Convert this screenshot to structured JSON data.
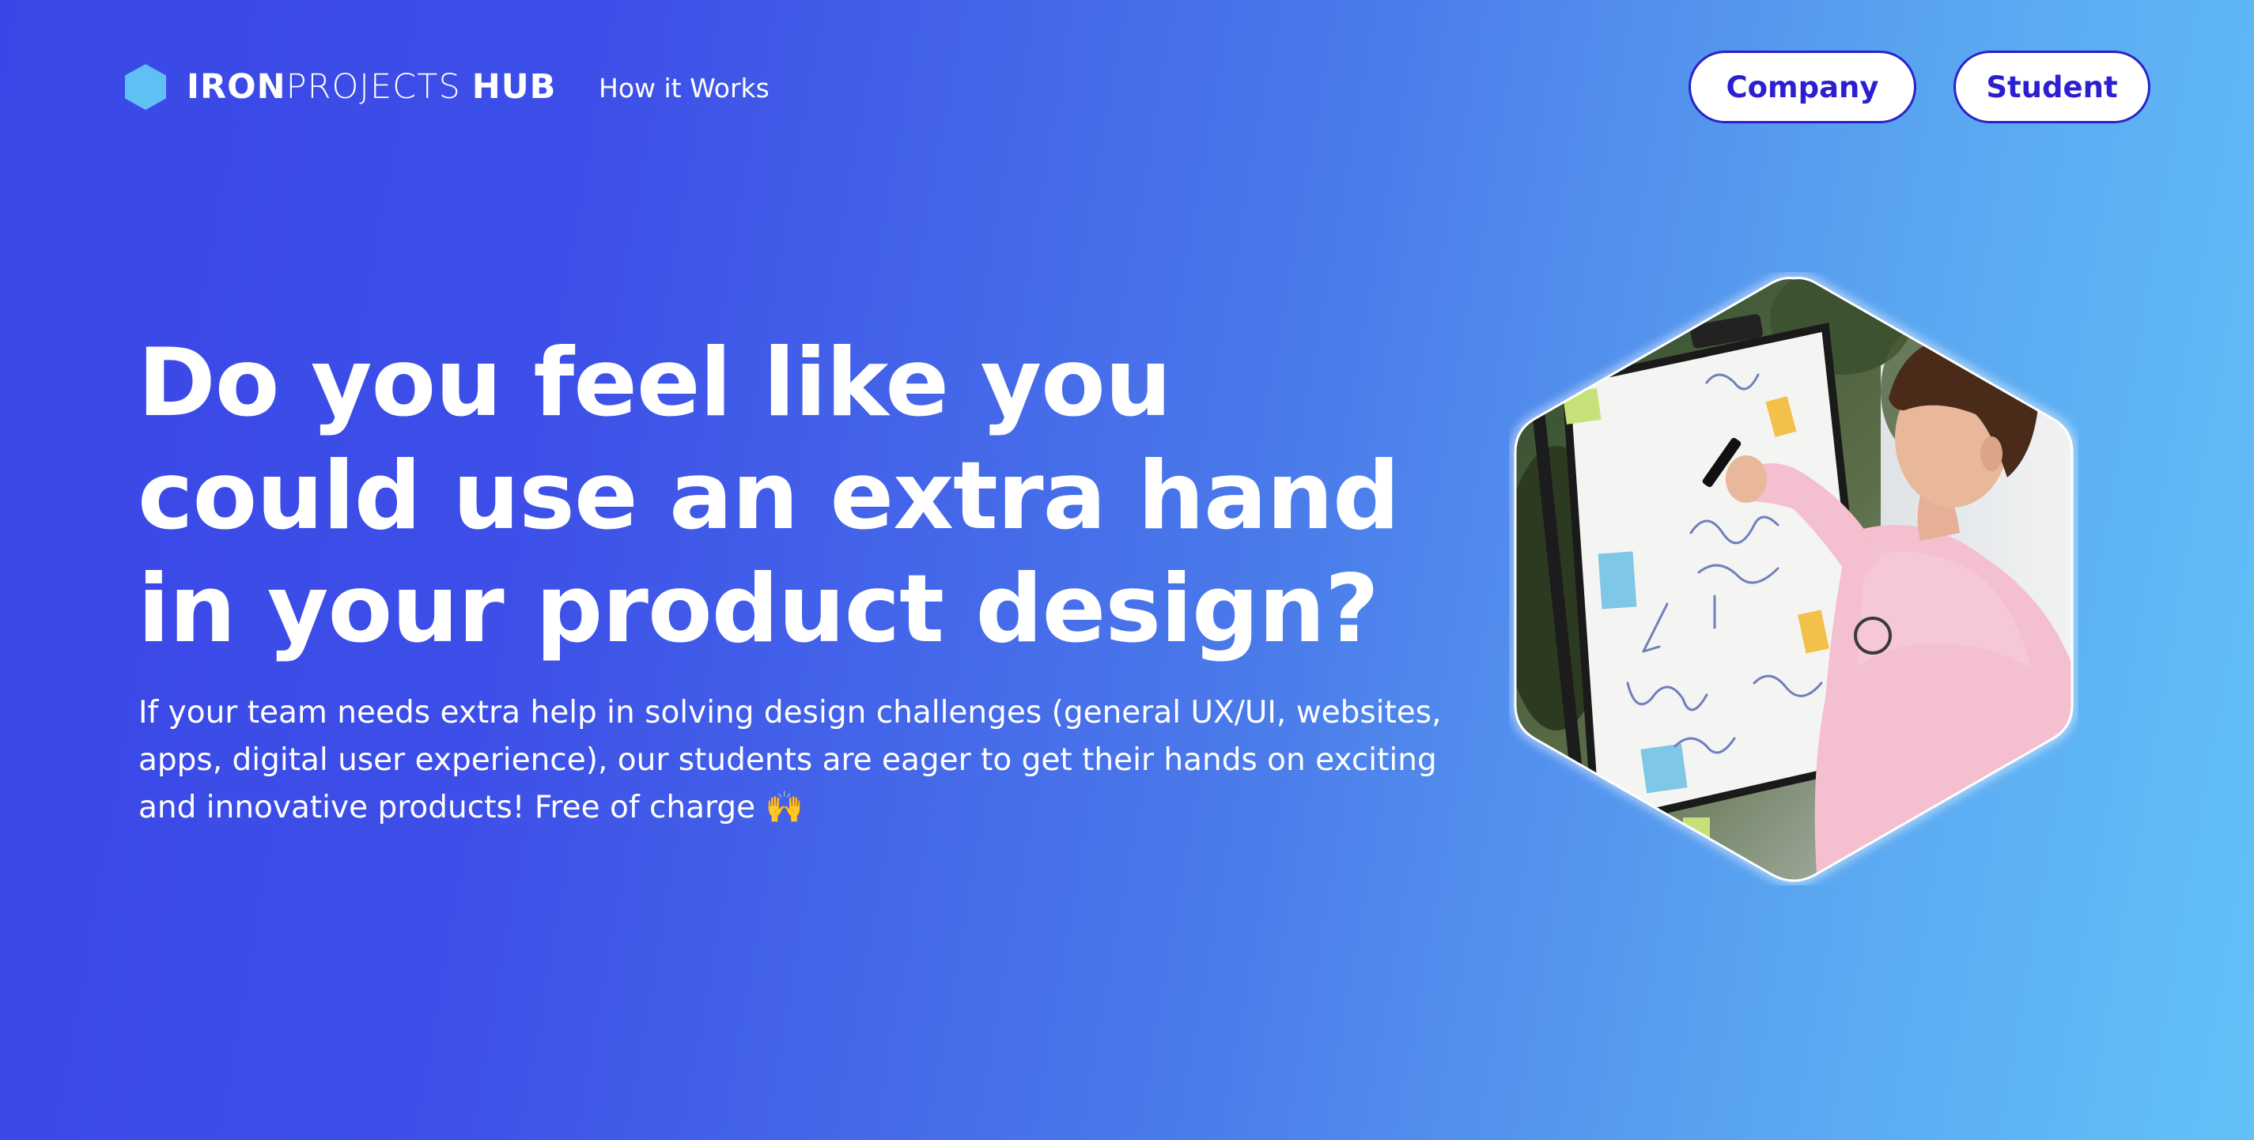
{
  "brand": {
    "part1": "IRON",
    "part2": "PROJECTS",
    "part3": "HUB",
    "logo_icon": "hexagon-logo-icon",
    "logo_color": "#5ec0f5"
  },
  "nav": {
    "how_it_works": "How it Works"
  },
  "actions": {
    "company_label": "Company",
    "student_label": "Student",
    "button_border_color": "#2a22c8",
    "button_text_color": "#2b1fd1"
  },
  "hero": {
    "title": "Do you feel like you could use an extra hand in your product design?",
    "subtitle": "If your team needs extra help in solving design challenges (general UX/UI, websites, apps, digital user experience), our students are eager to get their hands on exciting and innovative products! Free of charge 🙌",
    "image_subject": "photo of a person in a pink sweatshirt writing on a whiteboard with sticky notes"
  },
  "theme": {
    "gradient_start": "#3a47e6",
    "gradient_end": "#63c1f7"
  }
}
